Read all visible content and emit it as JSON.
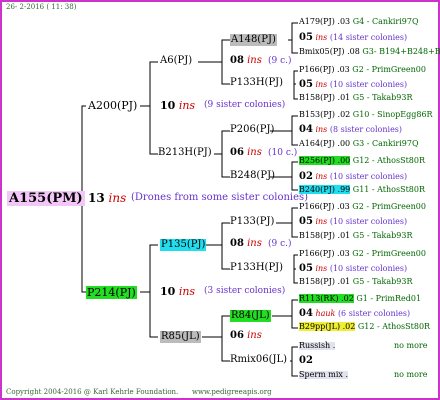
{
  "header": {
    "date": "26- 2-2016 ( 11: 38)"
  },
  "footer": {
    "copyright": "Copyright 2004-2016 @ Karl Kehrle Foundation.",
    "site": "www.pedigreeapis.org"
  },
  "root": {
    "name": "A155(PM)",
    "ins": "13 ins",
    "ins_num": "13",
    "ins_word": "ins",
    "note": "(Drones from some sister colonies)"
  },
  "gen1": {
    "sire": {
      "name": "A200(PJ)",
      "ins_num": "10",
      "ins_word": "ins",
      "note": "(9 sister colonies)"
    },
    "dam": {
      "name": "P214(PJ)",
      "ins_num": "10",
      "ins_word": "ins",
      "note": "(3 sister colonies)"
    }
  },
  "gen2": {
    "a6": {
      "name": "A6(PJ)",
      "ins_num": "08",
      "ins_word": "ins",
      "note": "(9 c.)"
    },
    "b213h": {
      "name": "B213H(PJ)",
      "ins_num": "06",
      "ins_word": "ins",
      "note": "(10 c.)"
    },
    "p135": {
      "name": "P135(PJ)",
      "ins_num": "08",
      "ins_word": "ins",
      "note": "(9 c.)"
    },
    "r85": {
      "name": "R85(JL)",
      "ins_num": "06",
      "ins_word": "ins",
      "note": ""
    }
  },
  "gen3": {
    "a148": {
      "name": "A148(PJ)"
    },
    "p133h_a": {
      "name": "P133H(PJ)"
    },
    "p206": {
      "name": "P206(PJ)"
    },
    "b248": {
      "name": "B248(PJ)"
    },
    "p133": {
      "name": "P133(PJ)"
    },
    "p133h_b": {
      "name": "P133H(PJ)"
    },
    "r84": {
      "name": "R84(JL)"
    },
    "rmix06": {
      "name": "Rmix06(JL)"
    }
  },
  "gen4": {
    "g1": {
      "top": "A179(PJ) .03",
      "top_src": "G4 - Cankiri97Q",
      "mid_num": "05",
      "mid_ins": "ins",
      "mid_note": "(14 sister colonies)",
      "bot": "Bmix05(PJ) .08",
      "bot_src": "G3- B194+B248+B"
    },
    "g2": {
      "top": "P166(PJ) .03",
      "top_src": "G2 - PrimGreen00",
      "mid_num": "05",
      "mid_ins": "ins",
      "mid_note": "(10 sister colonies)",
      "bot": "B158(PJ) .01",
      "bot_src": "G5 - Takab93R"
    },
    "g3": {
      "top": "B153(PJ) .02",
      "top_src": "G10 - SinopEgg86R",
      "mid_num": "04",
      "mid_ins": "ins",
      "mid_note": "(8 sister colonies)",
      "bot": "A164(PJ) .00",
      "bot_src": "G3 - Cankiri97Q"
    },
    "g4": {
      "top": "B256(PJ) .00",
      "top_src": "G12 - AthosSt80R",
      "mid_num": "02",
      "mid_ins": "ins",
      "mid_note": "(10 sister colonies)",
      "bot": "B240(PJ) .99",
      "bot_src": "G11 - AthosSt80R"
    },
    "g5": {
      "top": "P166(PJ) .03",
      "top_src": "G2 - PrimGreen00",
      "mid_num": "05",
      "mid_ins": "ins",
      "mid_note": "(10 sister colonies)",
      "bot": "B158(PJ) .01",
      "bot_src": "G5 - Takab93R"
    },
    "g6": {
      "top": "P166(PJ) .03",
      "top_src": "G2 - PrimGreen00",
      "mid_num": "05",
      "mid_ins": "ins",
      "mid_note": "(10 sister colonies)",
      "bot": "B158(PJ) .01",
      "bot_src": "G5 - Takab93R"
    },
    "g7": {
      "top": "R113(RK) .02",
      "top_src": "G1 - PrimRed01",
      "mid_num": "04",
      "mid_ins": "hauk",
      "mid_note": "(6 sister colonies)",
      "bot": "B29pp(JL) .02",
      "bot_src": "G12 - AthosSt80R"
    },
    "g8": {
      "top": "Russish .",
      "top_src": "no more",
      "mid_num": "02",
      "bot": "Sperm mix .",
      "bot_src": "no more"
    }
  },
  "colors": {
    "border": "#cc33cc",
    "ins": "#cc0000",
    "note": "#6633cc",
    "source": "#006600"
  }
}
